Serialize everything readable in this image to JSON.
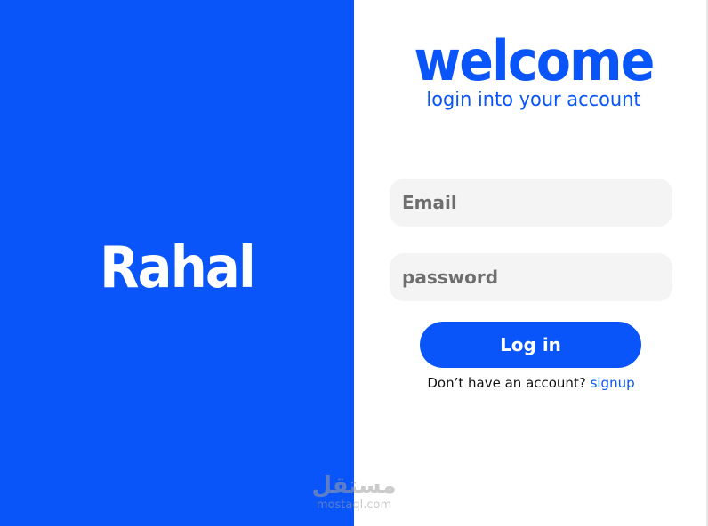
{
  "left_panel": {
    "brand_name": "Rahal"
  },
  "login_panel": {
    "title": "welcome",
    "subtitle": "login into your account",
    "email_field": {
      "placeholder": "Email",
      "value": ""
    },
    "password_field": {
      "placeholder": "password",
      "value": ""
    },
    "login_button_label": "Log in",
    "signup_prompt": "Don’t have an account?",
    "signup_link_label": "signup"
  },
  "watermark": {
    "logo_text": "مستقل",
    "url_text": "mostaql.com"
  },
  "colors": {
    "brand_blue": "#0a55fa",
    "field_background": "#f4f4f4",
    "placeholder_gray": "#6e6e6e",
    "page_background": "#ffffff"
  }
}
